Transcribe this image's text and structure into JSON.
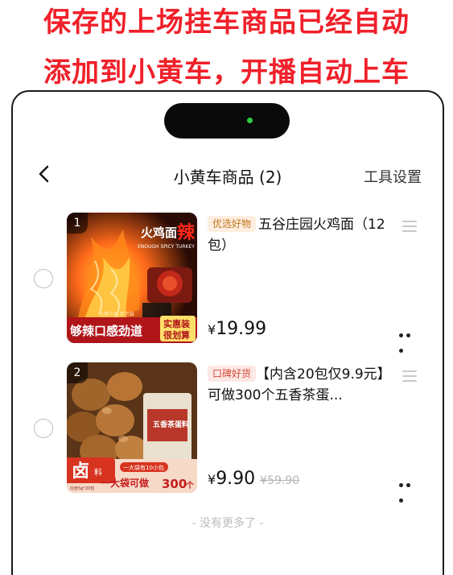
{
  "banner": {
    "line1": "保存的上场挂车商品已经自动",
    "line2": "添加到小黄车，开播自动上车"
  },
  "nav": {
    "title": "小黄车商品 (2)",
    "right_label": "工具设置"
  },
  "items": [
    {
      "index": "1",
      "tag": "优选好物",
      "title": "五谷庄园火鸡面（12包）",
      "currency": "¥",
      "price": "19.99",
      "original_price": "",
      "thumb_text": {
        "product": "火鸡面",
        "spicy": "辣",
        "english": "ENOUGH SPICY TURKEY",
        "small1": "无糖不吃 新包装",
        "slogan": "够辣口感劲道",
        "badge1": "实惠装",
        "badge2": "很划算"
      }
    },
    {
      "index": "2",
      "tag": "口碑好货",
      "title": "【内含20包仅9.9元】可做300个五香茶蛋...",
      "currency": "¥",
      "price": "9.90",
      "original_price": "¥59.90",
      "thumb_text": {
        "big": "卤",
        "small": "料",
        "tiny": "内含5g*20包",
        "line1": "一大袋有10小包",
        "line2": "一大袋可做",
        "count": "300",
        "unit": "个",
        "bag": "五香茶蛋料"
      }
    }
  ],
  "footer": "- 没有更多了 -",
  "colors": {
    "banner_red": "#f0202a",
    "tag1_bg": "#fdeee0",
    "tag2_bg": "#fde8e6"
  }
}
